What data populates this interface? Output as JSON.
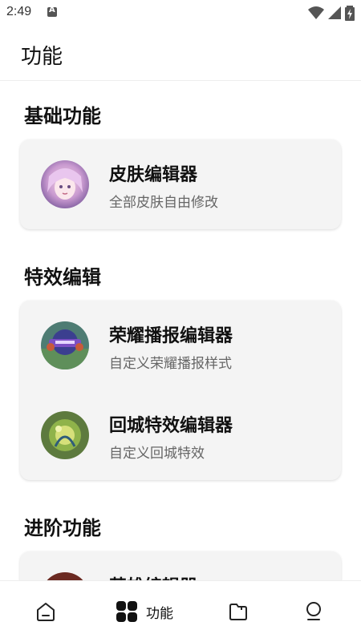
{
  "status": {
    "time": "2:49"
  },
  "app": {
    "title": "功能"
  },
  "sections": [
    {
      "title": "基础功能",
      "items": [
        {
          "title": "皮肤编辑器",
          "subtitle": "全部皮肤自由修改",
          "icon": "skin-avatar"
        }
      ]
    },
    {
      "title": "特效编辑",
      "items": [
        {
          "title": "荣耀播报编辑器",
          "subtitle": "自定义荣耀播报样式",
          "icon": "broadcast-avatar"
        },
        {
          "title": "回城特效编辑器",
          "subtitle": "自定义回城特效",
          "icon": "recall-avatar"
        }
      ]
    },
    {
      "title": "进阶功能",
      "items": [
        {
          "title": "英雄编辑器",
          "subtitle": "",
          "icon": "hero-avatar"
        }
      ]
    }
  ],
  "nav": {
    "items": [
      {
        "icon": "home-icon"
      },
      {
        "icon": "grid-icon",
        "label": "功能",
        "active": true
      },
      {
        "icon": "folder-icon"
      },
      {
        "icon": "profile-icon"
      }
    ]
  },
  "colors": {
    "card": "#f4f4f4",
    "subtitle": "#666666",
    "text": "#111111"
  }
}
